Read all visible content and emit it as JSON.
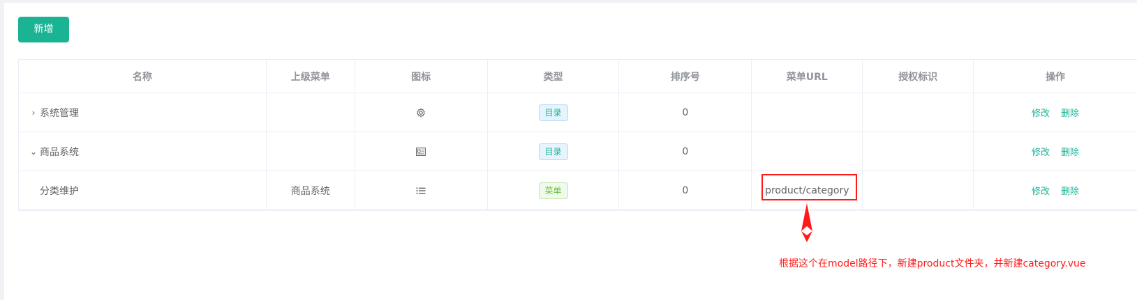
{
  "toolbar": {
    "add_label": "新增"
  },
  "table": {
    "headers": [
      "名称",
      "上级菜单",
      "图标",
      "类型",
      "排序号",
      "菜单URL",
      "授权标识",
      "操作"
    ],
    "rows": [
      {
        "expand": "›",
        "name": "系统管理",
        "parent": "",
        "icon": "gear-icon",
        "type": "目录",
        "order": "0",
        "url": "",
        "perms": "",
        "edit": "修改",
        "delete": "删除"
      },
      {
        "expand": "⌄",
        "name": "商品系统",
        "parent": "",
        "icon": "id-card-icon",
        "type": "目录",
        "order": "0",
        "url": "",
        "perms": "",
        "edit": "修改",
        "delete": "删除"
      },
      {
        "expand": "",
        "name": "分类维护",
        "parent": "商品系统",
        "icon": "list-icon",
        "type": "菜单",
        "order": "0",
        "url": "product/category",
        "perms": "",
        "edit": "修改",
        "delete": "删除"
      }
    ]
  },
  "annotation": {
    "note": "根据这个在model路径下，新建product文件夹，并新建category.vue",
    "color": "#ff1a1a"
  },
  "colors": {
    "accent": "#1ab394"
  }
}
